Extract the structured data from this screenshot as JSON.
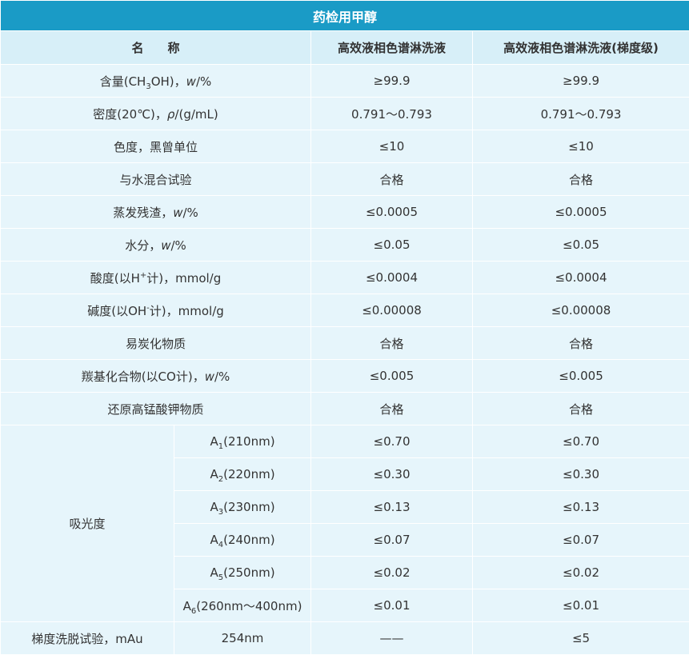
{
  "title": "药检用甲醇",
  "headers": {
    "name": "名　　称",
    "col_hplc": "高效液相色谱淋洗液",
    "col_gradient": "高效液相色谱淋洗液(梯度级)"
  },
  "rows": [
    {
      "name_pre": "含量(CH",
      "name_sub": "3",
      "name_post": "OH)，",
      "name_ital": "w",
      "name_tail": "/%",
      "hplc": "≥99.9",
      "gradient": "≥99.9"
    },
    {
      "name_pre": "密度(20℃)，",
      "name_ital": "ρ",
      "name_tail": "/(g/mL)",
      "hplc": "0.791～0.793",
      "gradient": "0.791～0.793"
    },
    {
      "name": "色度，黑曾单位",
      "hplc": "≤10",
      "gradient": "≤10"
    },
    {
      "name": "与水混合试验",
      "hplc": "合格",
      "gradient": "合格"
    },
    {
      "name_pre": "蒸发残渣，",
      "name_ital": "w",
      "name_tail": "/%",
      "hplc": "≤0.0005",
      "gradient": "≤0.0005"
    },
    {
      "name_pre": "水分，",
      "name_ital": "w",
      "name_tail": "/%",
      "hplc": "≤0.05",
      "gradient": "≤0.05"
    },
    {
      "name_pre": "酸度(以H",
      "name_sup": "+",
      "name_post": "计)，mmol/g",
      "hplc": "≤0.0004",
      "gradient": "≤0.0004"
    },
    {
      "name_pre": "碱度(以OH",
      "name_sup": "-",
      "name_post": "计)，mmol/g",
      "hplc": "≤0.00008",
      "gradient": "≤0.00008"
    },
    {
      "name": "易炭化物质",
      "hplc": "合格",
      "gradient": "合格"
    },
    {
      "name_pre": "羰基化合物(以CO计)，",
      "name_ital": "w",
      "name_tail": "/%",
      "hplc": "≤0.005",
      "gradient": "≤0.005"
    },
    {
      "name": "还原高锰酸钾物质",
      "hplc": "合格",
      "gradient": "合格"
    }
  ],
  "absorbance": {
    "label": "吸光度",
    "items": [
      {
        "pre": "A",
        "sub": "1",
        "post": "(210nm)",
        "hplc": "≤0.70",
        "gradient": "≤0.70"
      },
      {
        "pre": "A",
        "sub": "2",
        "post": "(220nm)",
        "hplc": "≤0.30",
        "gradient": "≤0.30"
      },
      {
        "pre": "A",
        "sub": "3",
        "post": "(230nm)",
        "hplc": "≤0.13",
        "gradient": "≤0.13"
      },
      {
        "pre": "A",
        "sub": "4",
        "post": "(240nm)",
        "hplc": "≤0.07",
        "gradient": "≤0.07"
      },
      {
        "pre": "A",
        "sub": "5",
        "post": "(250nm)",
        "hplc": "≤0.02",
        "gradient": "≤0.02"
      },
      {
        "pre": "A",
        "sub": "6",
        "post": "(260nm～400nm)",
        "hplc": "≤0.01",
        "gradient": "≤0.01"
      }
    ]
  },
  "gradient_test": {
    "label": "梯度洗脱试验，mAu",
    "wavelength": "254nm",
    "hplc": "——",
    "gradient": "≤5"
  },
  "colors": {
    "title_bg": "#1a9bc6",
    "header_bg": "#d7eff8",
    "cell_bg": "#e6f5fb"
  }
}
